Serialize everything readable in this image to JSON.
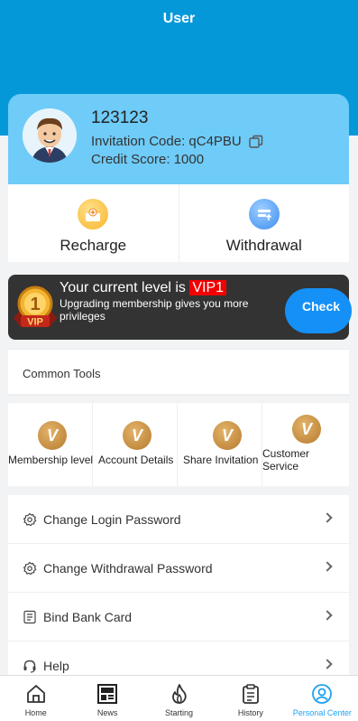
{
  "header": {
    "title": "User"
  },
  "profile": {
    "username": "123123",
    "invitation_code": "Invitation Code: qC4PBU",
    "credit_score": "Credit Score: 1000"
  },
  "money": {
    "recharge_label": "Recharge",
    "withdrawal_label": "Withdrawal"
  },
  "vip": {
    "current_prefix": "Your current level is ",
    "level": "VIP1",
    "message": "Upgrading membership gives you more privileges",
    "check_label": "Check",
    "badge_icon": "vip-medal-icon"
  },
  "tools": {
    "title": "Common Tools",
    "items": [
      {
        "label": "Membership level",
        "icon": "v-coin-icon",
        "glyph": "V"
      },
      {
        "label": "Account Details",
        "icon": "v-coin-icon",
        "glyph": "V"
      },
      {
        "label": "Share Invitation",
        "icon": "v-coin-icon",
        "glyph": "V"
      },
      {
        "label": "Customer Service",
        "icon": "v-coin-icon",
        "glyph": "V"
      }
    ]
  },
  "settings": {
    "items": [
      {
        "label": "Change Login Password",
        "icon": "gear-icon"
      },
      {
        "label": "Change Withdrawal Password",
        "icon": "gear-icon"
      },
      {
        "label": "Bind Bank Card",
        "icon": "card-list-icon"
      },
      {
        "label": "Help",
        "icon": "headset-icon"
      }
    ]
  },
  "tabbar": {
    "items": [
      {
        "label": "Home",
        "icon": "home-icon"
      },
      {
        "label": "News",
        "icon": "news-icon"
      },
      {
        "label": "Starting",
        "icon": "flame-icon"
      },
      {
        "label": "History",
        "icon": "clipboard-icon"
      },
      {
        "label": "Personal Center",
        "icon": "person-icon",
        "active": true
      }
    ]
  },
  "colors": {
    "header_blue": "#0598d9",
    "profile_blue": "#6fcbf7",
    "check_blue": "#1590f6",
    "vip_red": "#f20000",
    "active_tab": "#1da1f2"
  }
}
